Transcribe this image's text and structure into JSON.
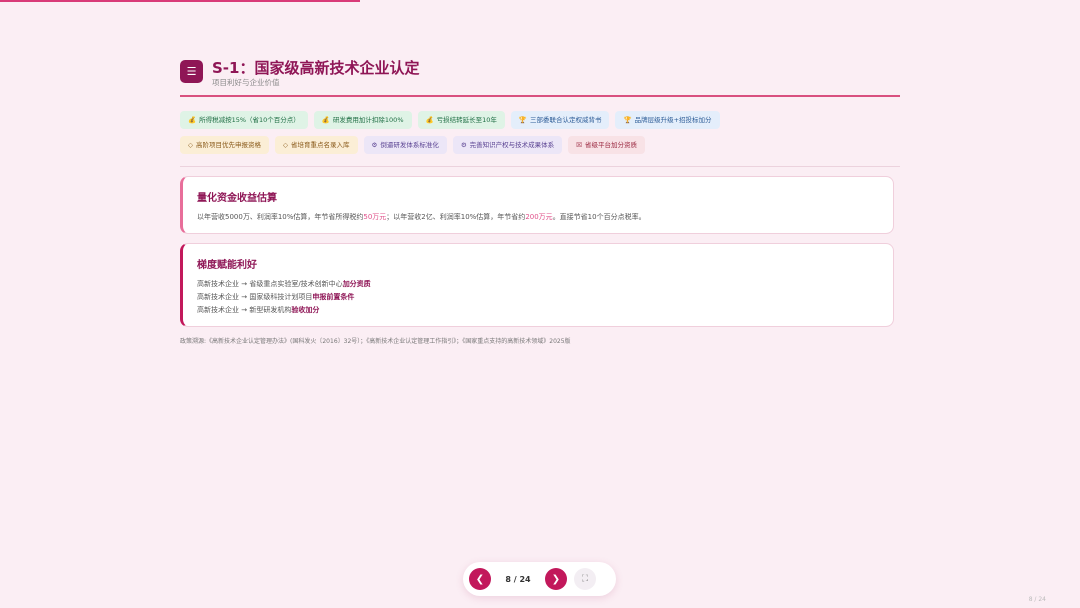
{
  "header": {
    "badge_icon": "list-icon",
    "badge_glyph": "☰",
    "title": "S-1：国家级高新技术企业认定",
    "subtitle": "项目利好与企业价值"
  },
  "tags": {
    "row1": [
      {
        "icon": "💰",
        "label": "所得税减按15%（省10个百分点）",
        "color": "green"
      },
      {
        "icon": "💰",
        "label": "研发费用加计扣除100%",
        "color": "green"
      },
      {
        "icon": "💰",
        "label": "亏损结转延长至10年",
        "color": "green"
      },
      {
        "icon": "🏆",
        "label": "三部委联合认定权威背书",
        "color": "blue"
      },
      {
        "icon": "🏆",
        "label": "品牌层级升级+招投标加分",
        "color": "blue"
      }
    ],
    "row2": [
      {
        "icon": "◇",
        "label": "高阶项目优先申报资格",
        "color": "amber"
      },
      {
        "icon": "◇",
        "label": "省培育重点名录入库",
        "color": "amber"
      },
      {
        "icon": "⚙",
        "label": "倒逼研发体系标准化",
        "color": "purple"
      },
      {
        "icon": "⚙",
        "label": "完善知识产权与技术成果体系",
        "color": "purple"
      },
      {
        "icon": "☒",
        "label": "省级平台加分资质",
        "color": "red"
      }
    ]
  },
  "card1": {
    "title": "量化资金收益估算",
    "t1": "以年营收5000万、利润率10%估算，年节省所得税约",
    "h1": "50万元",
    "t2": "；以年营收2亿、利润率10%估算，年节省约",
    "h2": "200万元",
    "t3": "。直接节省10个百分点税率。"
  },
  "card2": {
    "title": "梯度赋能利好",
    "lines": [
      {
        "text": "高新技术企业 → 省级重点实验室/技术创新中心",
        "strong": "加分资质"
      },
      {
        "text": "高新技术企业 → 国家级科技计划项目",
        "strong": "申报前置条件"
      },
      {
        "text": "高新技术企业 → 新型研发机构",
        "strong": "验收加分"
      }
    ]
  },
  "source": "政策溯源:《高新技术企业认定管理办法》(国科发火〔2016〕32号）；《高新技术企业认定管理工作指引》；《国家重点支持的高新技术领域》2025版",
  "nav": {
    "prev_glyph": "❮",
    "next_glyph": "❯",
    "page_indicator": "8 / 24",
    "fullscreen_glyph": "⛶"
  },
  "corner_page": "8 / 24",
  "colors": {
    "accent": "#8f1656",
    "highlight": "#e0508a",
    "background": "#fbeef4"
  }
}
